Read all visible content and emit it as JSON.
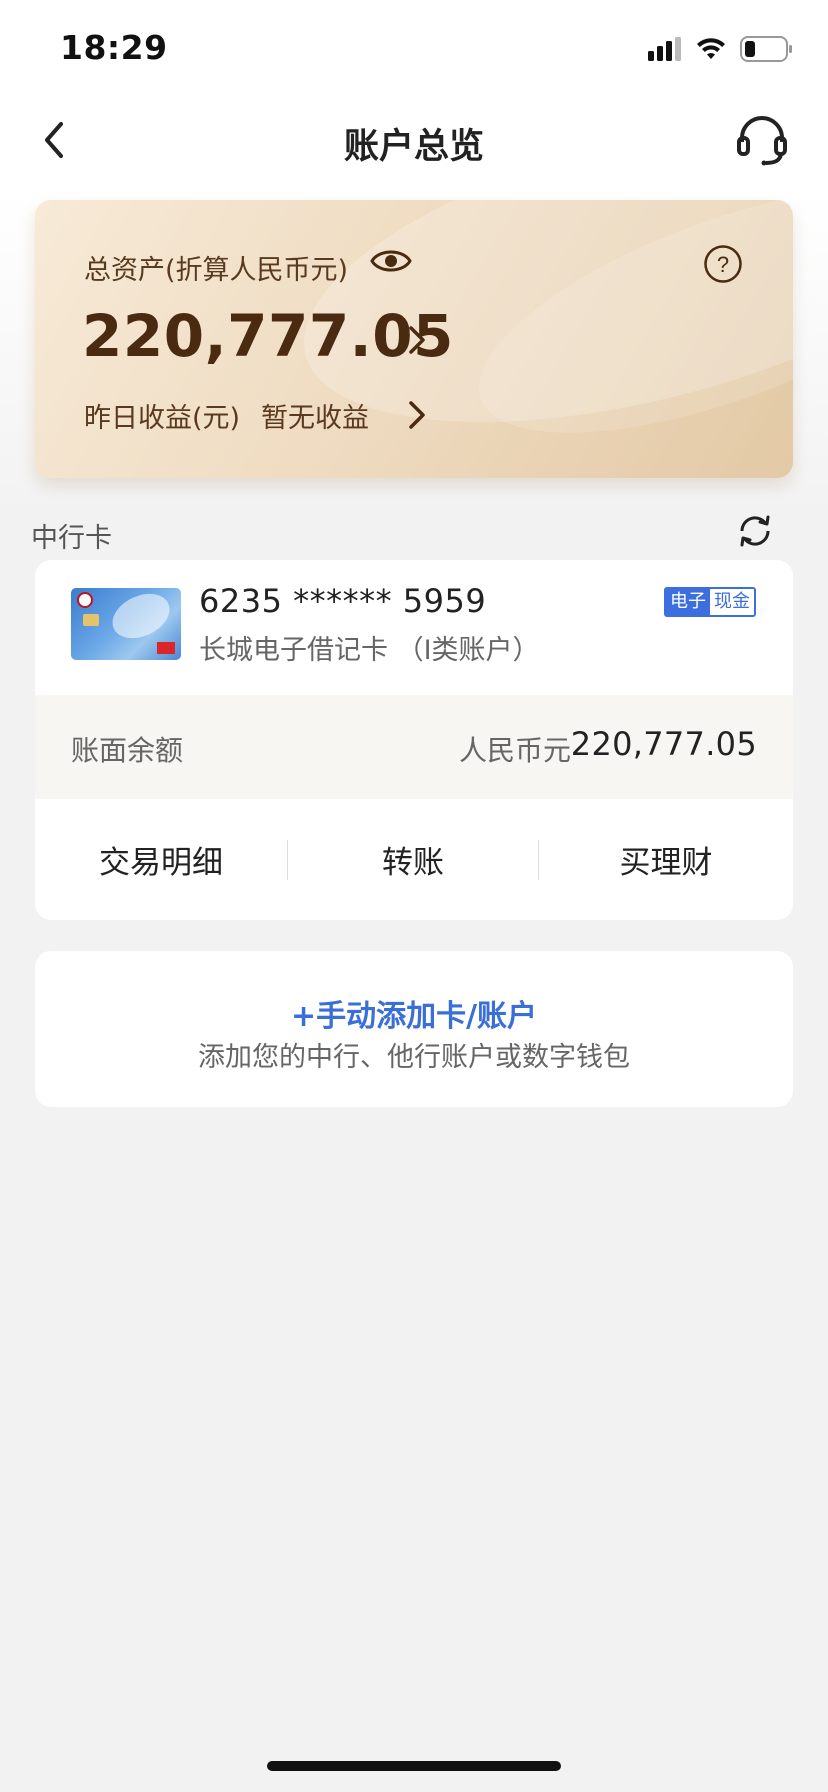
{
  "status_bar": {
    "time": "18:29"
  },
  "header": {
    "title": "账户总览"
  },
  "asset_card": {
    "label": "总资产(折算人民币元)",
    "total": "220,777.05",
    "yesterday_label": "昨日收益(元)",
    "yesterday_value": "暂无收益"
  },
  "section": {
    "label": "中行卡"
  },
  "account": {
    "number": "6235 ****** 5959",
    "name": "长城电子借记卡 （I类账户）",
    "badge_primary": "电子",
    "badge_secondary": "现金",
    "balance_label": "账面余额",
    "balance_currency": "人民币元",
    "balance_value": "220,777.05",
    "actions": [
      {
        "label": "交易明细"
      },
      {
        "label": "转账"
      },
      {
        "label": "买理财"
      }
    ]
  },
  "add_account": {
    "title": "+手动添加卡/账户",
    "subtitle": "添加您的中行、他行账户或数字钱包"
  },
  "colors": {
    "accent_blue": "#3a6fd8",
    "asset_text": "#4a2a10",
    "background": "#f2f2f2"
  },
  "icons": [
    "back-icon",
    "headset-icon",
    "eye-icon",
    "question-icon",
    "chevron-right-icon",
    "refresh-icon",
    "signal-icon",
    "wifi-icon",
    "battery-icon"
  ]
}
